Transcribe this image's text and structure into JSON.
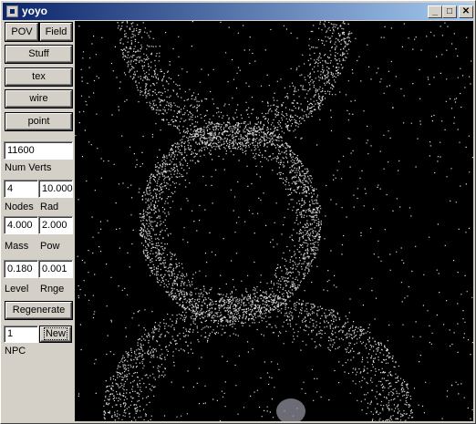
{
  "window": {
    "title": "yoyo",
    "min_glyph": "_",
    "max_glyph": "□",
    "close_glyph": "✕"
  },
  "controls": {
    "pov_label": "POV",
    "field_label": "Field",
    "stuff_label": "Stuff",
    "tex_label": "tex",
    "wire_label": "wire",
    "point_label": "point",
    "num_verts_value": "11600",
    "num_verts_label": "Num Verts",
    "nodes_value": "4",
    "rad_value": "10.000",
    "nodes_label": "Nodes",
    "rad_label": "Rad",
    "mass_value": "4.000",
    "pow_value": "2.000",
    "mass_label": "Mass",
    "pow_label": "Pow",
    "level_value": "0.180",
    "rnge_value": "0.001",
    "level_label": "Level",
    "rnge_label": "Rnge",
    "regenerate_label": "Regenerate",
    "npc_value": "1",
    "new_label": "New",
    "npc_label": "NPC"
  },
  "colors": {
    "titlebar_start": "#0a246a",
    "titlebar_end": "#a6caf0",
    "viewport_bg": "#000000",
    "point": "#ffffff"
  }
}
